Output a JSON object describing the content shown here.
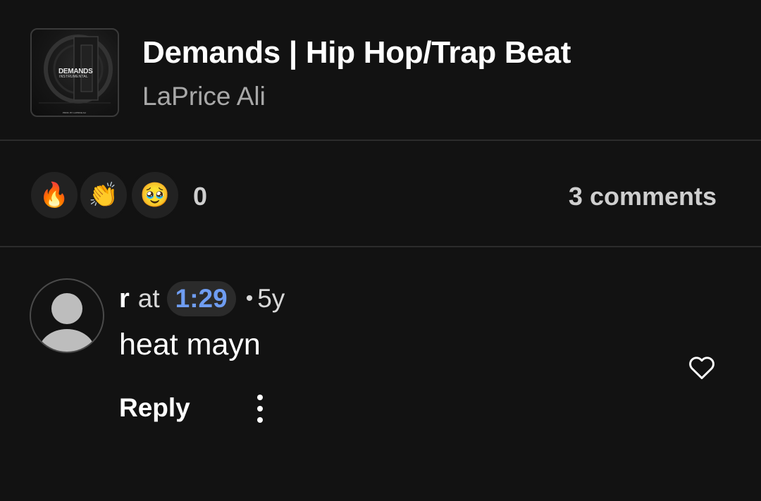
{
  "track": {
    "title": "Demands | Hip Hop/Trap Beat",
    "artist": "LaPrice Ali",
    "artwork": {
      "title": "DEMANDS",
      "subtitle": "INSTRUMENTAL",
      "credit": "PROD. BY LAPRICE ALI"
    }
  },
  "reactions": {
    "items": [
      {
        "name": "fire",
        "emoji": "🔥"
      },
      {
        "name": "clapping-hands",
        "emoji": "👏"
      },
      {
        "name": "pleading-face",
        "emoji": "🥹"
      }
    ],
    "count": "0",
    "comments_label": "3 comments"
  },
  "comment": {
    "username": "r",
    "at_label": "at",
    "timestamp": "1:29",
    "separator": "•",
    "age": "5y",
    "text": "heat mayn",
    "reply_label": "Reply",
    "like_icon": "heart-outline-icon",
    "more_icon": "vertical-ellipsis-icon"
  },
  "colors": {
    "background": "#121212",
    "divider": "#2c2c2c",
    "timestamp_link": "#6f9df2",
    "secondary_text": "#a8a8a8"
  }
}
